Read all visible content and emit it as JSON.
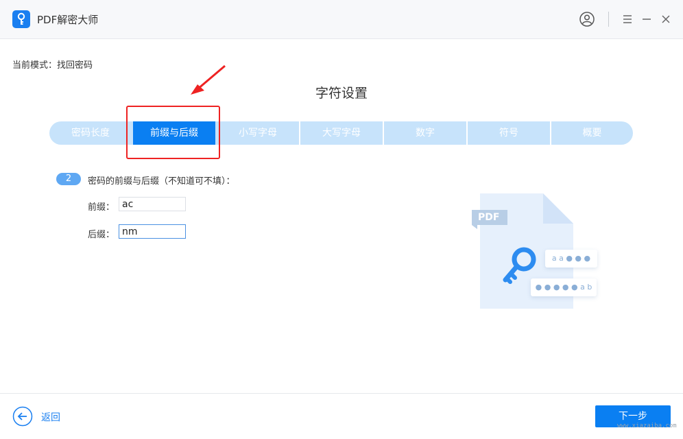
{
  "app": {
    "title": "PDF解密大师"
  },
  "mode": {
    "text": "当前模式：找回密码"
  },
  "page": {
    "title": "字符设置"
  },
  "tabs": [
    {
      "label": "密码长度",
      "active": false
    },
    {
      "label": "前缀与后缀",
      "active": true
    },
    {
      "label": "小写字母",
      "active": false
    },
    {
      "label": "大写字母",
      "active": false
    },
    {
      "label": "数字",
      "active": false
    },
    {
      "label": "符号",
      "active": false
    },
    {
      "label": "概要",
      "active": false
    }
  ],
  "step": {
    "number": "2",
    "label": "密码的前缀与后缀（不知道可不填）："
  },
  "fields": {
    "prefix": {
      "label": "前缀：",
      "value": "ac"
    },
    "suffix": {
      "label": "后缀：",
      "value": "nm"
    }
  },
  "illustration": {
    "doc_label": "PDF",
    "pill_top": "a a ● ● ●",
    "pill_bottom": "● ● ● ● ● a b"
  },
  "footer": {
    "back_label": "返回",
    "next_label": "下一步"
  },
  "watermark": "www.xiazaiba.com",
  "colors": {
    "accent": "#0a7ff2",
    "tab_inactive": "#c7e3fb",
    "annotation": "#ee2222"
  }
}
